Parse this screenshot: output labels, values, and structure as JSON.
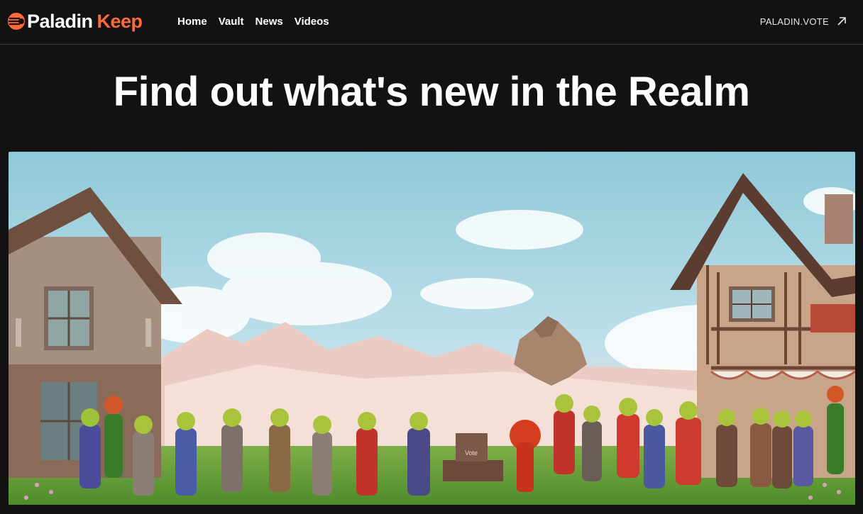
{
  "brand": {
    "word1": "Paladin",
    "word2": "Keep",
    "accent_color": "#ff6a3d",
    "icon": "paladin-logo-icon"
  },
  "nav": {
    "items": [
      "Home",
      "Vault",
      "News",
      "Videos"
    ]
  },
  "external_link": {
    "label": "PALADIN.VOTE",
    "icon": "arrow-up-right-icon"
  },
  "hero": {
    "headline": "Find out what's new in the Realm",
    "image": {
      "ballot_box_label": "Vote"
    }
  }
}
